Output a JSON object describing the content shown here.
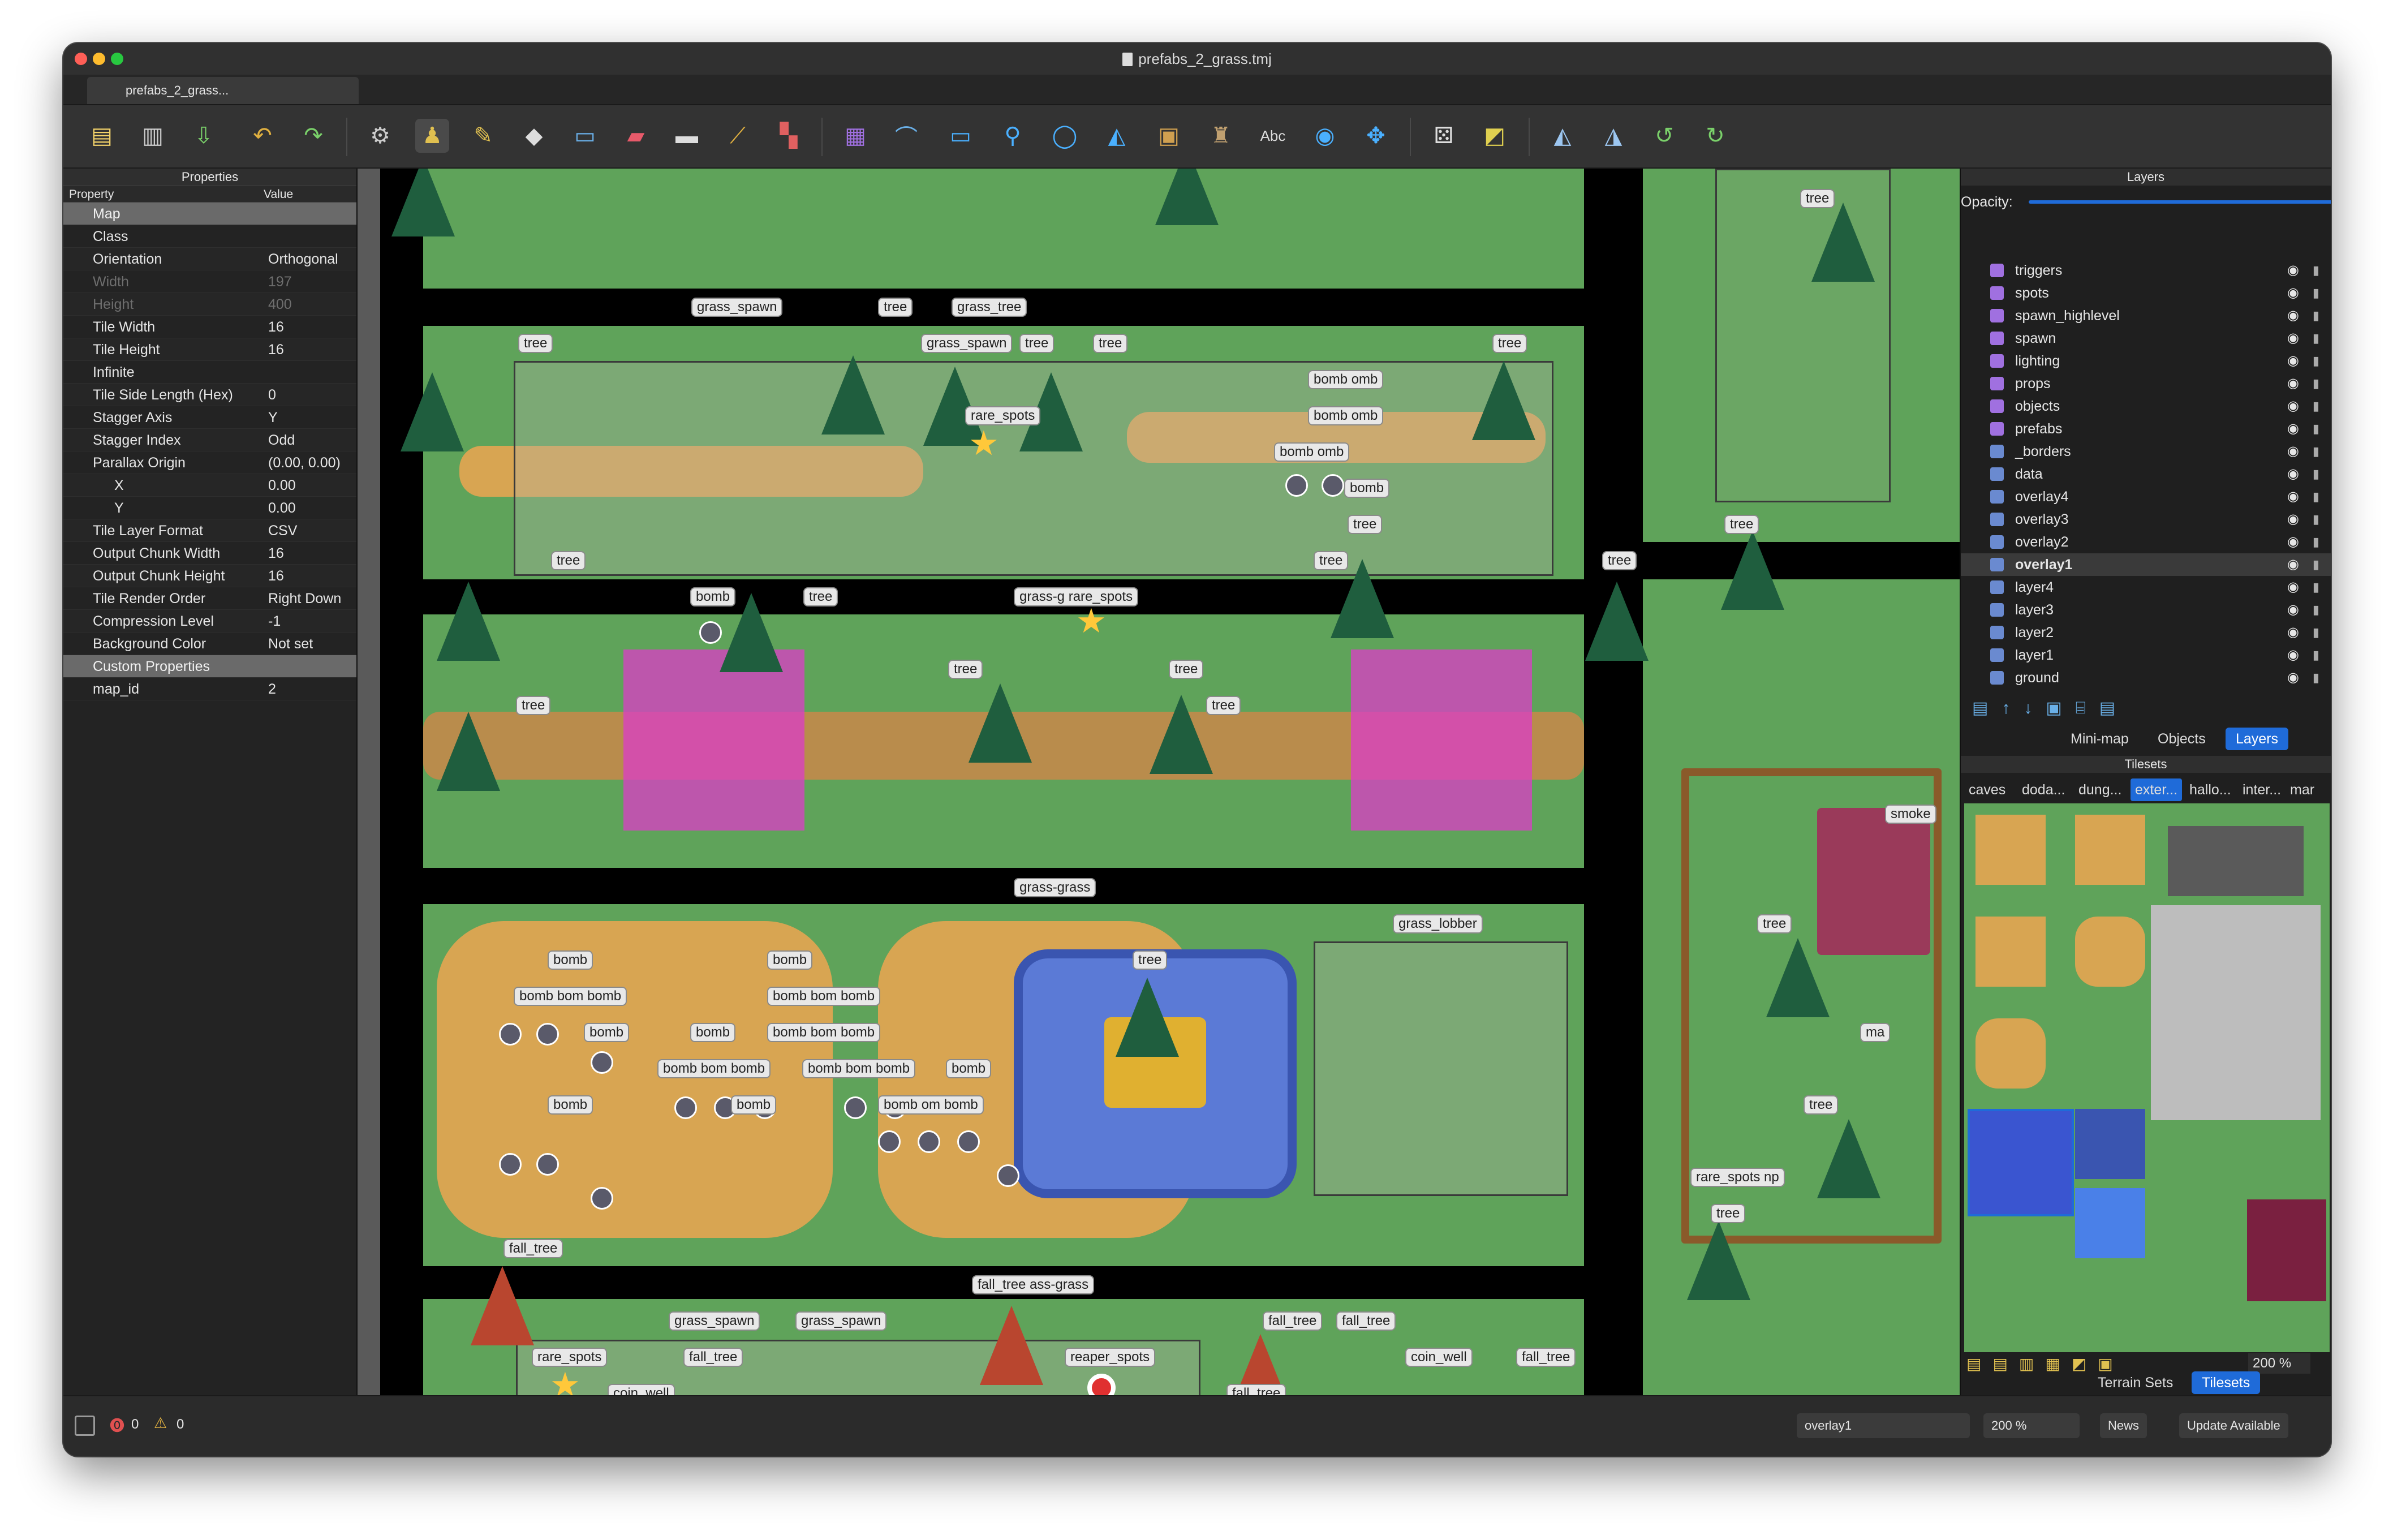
{
  "window": {
    "title": "prefabs_2_grass.tmj",
    "tab": "prefabs_2_grass..."
  },
  "properties": {
    "panel_title": "Properties",
    "col_property": "Property",
    "col_value": "Value",
    "rows": [
      {
        "k": "Map",
        "v": "",
        "group": true
      },
      {
        "k": "Class",
        "v": ""
      },
      {
        "k": "Orientation",
        "v": "Orthogonal"
      },
      {
        "k": "Width",
        "v": "197",
        "dim": true
      },
      {
        "k": "Height",
        "v": "400",
        "dim": true
      },
      {
        "k": "Tile Width",
        "v": "16"
      },
      {
        "k": "Tile Height",
        "v": "16"
      },
      {
        "k": "Infinite",
        "v": ""
      },
      {
        "k": "Tile Side Length (Hex)",
        "v": "0"
      },
      {
        "k": "Stagger Axis",
        "v": "Y"
      },
      {
        "k": "Stagger Index",
        "v": "Odd"
      },
      {
        "k": "Parallax Origin",
        "v": "(0.00, 0.00)"
      },
      {
        "k": "X",
        "v": "0.00",
        "indent": true
      },
      {
        "k": "Y",
        "v": "0.00",
        "indent": true
      },
      {
        "k": "Tile Layer Format",
        "v": "CSV"
      },
      {
        "k": "Output Chunk Width",
        "v": "16"
      },
      {
        "k": "Output Chunk Height",
        "v": "16"
      },
      {
        "k": "Tile Render Order",
        "v": "Right Down"
      },
      {
        "k": "Compression Level",
        "v": "-1"
      },
      {
        "k": "Background Color",
        "v": "Not set"
      },
      {
        "k": "Custom Properties",
        "v": "",
        "group": true
      },
      {
        "k": "map_id",
        "v": "2"
      }
    ]
  },
  "layers": {
    "panel_title": "Layers",
    "opacity_label": "Opacity:",
    "opacity": 1.0,
    "items": [
      {
        "name": "triggers",
        "type": "object"
      },
      {
        "name": "spots",
        "type": "object"
      },
      {
        "name": "spawn_highlevel",
        "type": "object"
      },
      {
        "name": "spawn",
        "type": "object"
      },
      {
        "name": "lighting",
        "type": "object"
      },
      {
        "name": "props",
        "type": "object"
      },
      {
        "name": "objects",
        "type": "object"
      },
      {
        "name": "prefabs",
        "type": "object"
      },
      {
        "name": "_borders",
        "type": "tile"
      },
      {
        "name": "data",
        "type": "tile"
      },
      {
        "name": "overlay4",
        "type": "tile"
      },
      {
        "name": "overlay3",
        "type": "tile"
      },
      {
        "name": "overlay2",
        "type": "tile"
      },
      {
        "name": "overlay1",
        "type": "tile",
        "selected": true
      },
      {
        "name": "layer4",
        "type": "tile"
      },
      {
        "name": "layer3",
        "type": "tile"
      },
      {
        "name": "layer2",
        "type": "tile"
      },
      {
        "name": "layer1",
        "type": "tile"
      },
      {
        "name": "ground",
        "type": "tile"
      }
    ],
    "tabs": [
      "Mini-map",
      "Objects",
      "Layers"
    ]
  },
  "tilesets": {
    "panel_title": "Tilesets",
    "tabs": [
      "caves",
      "doda...",
      "dung...",
      "exter...",
      "hallo...",
      "inter...",
      "mar"
    ],
    "zoom": "200 %",
    "bottom_tabs": [
      "Terrain Sets",
      "Tilesets"
    ]
  },
  "map_labels": {
    "l1": "tree",
    "l2": "grass_spawn",
    "l3": "tree",
    "l4": "grass_tree",
    "l5": "tree",
    "l6": "grass_spawn",
    "l7": "tree",
    "l8": "tree",
    "l9": "tree",
    "l10": "bomb omb",
    "l11": "bomb omb",
    "l12": "bomb omb",
    "l13": "bomb",
    "l14": "rare_spots",
    "l15": "tree",
    "l16": "tree",
    "l17": "tree",
    "l18": "bomb",
    "l19": "tree",
    "l20": "grass-g rare_spots",
    "l21": "tree",
    "l22": "tree",
    "l23": "tree",
    "l24": "tree",
    "l25": "tree",
    "l26": "grass-grass",
    "l27": "grass_lobber",
    "l28": "tree",
    "l29": "bomb",
    "l30": "bomb bom bomb",
    "l31": "bomb",
    "l32": "bomb bom bomb",
    "l33": "bomb",
    "l34": "bomb bom bomb",
    "l35": "bomb bom bomb",
    "l36": "bomb",
    "l37": "bomb",
    "l38": "bomb",
    "l39": "bomb bom bomb",
    "l40": "bomb om bomb",
    "l41": "bomb",
    "l42": "fall_tree",
    "l43": "fall_tree ass-grass",
    "l44": "grass_spawn",
    "l45": "grass_spawn",
    "l46": "fall_tree",
    "l47": "fall_tree",
    "l48": "rare_spots",
    "l49": "fall_tree",
    "l50": "reaper_spots",
    "l51": "coin_well",
    "l52": "fall_tree",
    "l53": "coin_well",
    "l54": "fall_tree",
    "l55": "fall_tree",
    "l56": "tree",
    "l57": "tree",
    "l58": "smoke",
    "l59": "tree",
    "l60": "ma",
    "l61": "tree",
    "l62": "rare_spots np",
    "l63": "tree"
  },
  "status": {
    "errors": "0",
    "warnings": "0",
    "layer_select": "overlay1",
    "zoom": "200 %",
    "news": "News",
    "update": "Update Available"
  }
}
